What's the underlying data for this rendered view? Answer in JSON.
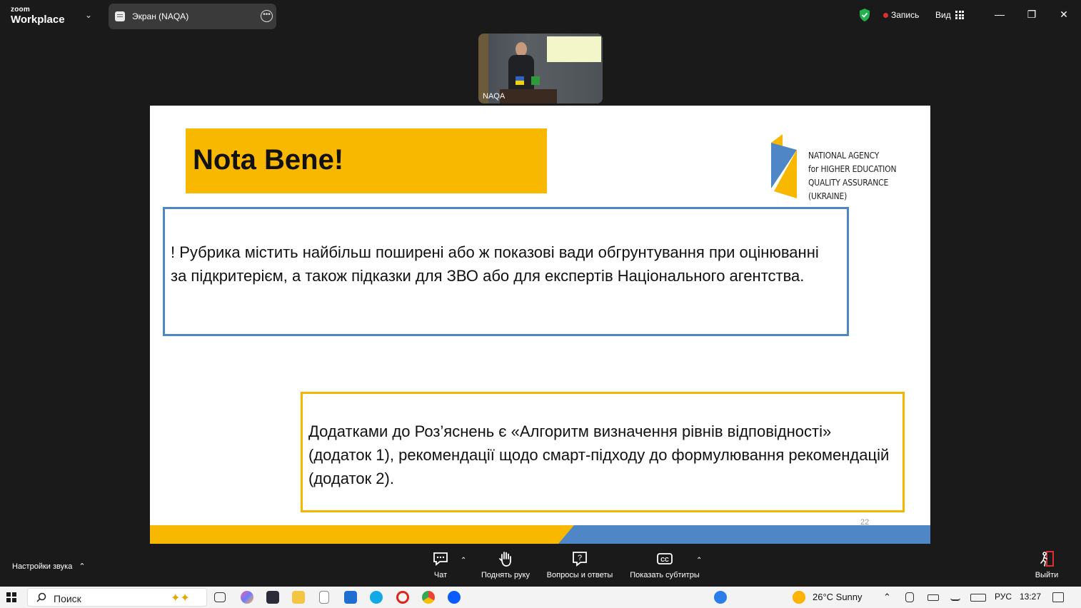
{
  "app": {
    "brand_small": "zoom",
    "brand_name": "Workplace",
    "tab_label": "Экран (NAQA)",
    "record_label": "Запись",
    "view_label": "Вид",
    "colors": {
      "bg": "#1a1a1a",
      "record": "#e02f2f",
      "shield": "#22b14c"
    }
  },
  "video": {
    "name": "NAQA"
  },
  "slide": {
    "heading": "Nota Bene!",
    "logo_lines": [
      "NATIONAL AGENCY",
      "for HIGHER EDUCATION",
      "QUALITY ASSURANCE",
      "(UKRAINE)"
    ],
    "box1_text": "! Рубрика містить найбільш поширені або ж показові вади обгрунтування при оцінюванні за підкритерієм, а також підказки для  ЗВО або для експертів Національного агентства.",
    "box2_text": "Додатками до Роз’яснень є «Алгоритм визначення рівнів відповідності» (додаток 1), рекомендації  щодо смарт-підходу до формулювання рекомендацій (додаток 2).",
    "page_number": "22",
    "colors": {
      "yellow": "#f9b800",
      "blue": "#4f86c6"
    }
  },
  "toolbar": {
    "audio_settings": "Настройки звука",
    "chat": "Чат",
    "raise_hand": "Поднять руку",
    "qa": "Вопросы и ответы",
    "captions": "Показать субтитры",
    "leave": "Выйти"
  },
  "taskbar": {
    "search_placeholder": "Поиск",
    "weather": "26°C  Sunny",
    "language": "РУС",
    "time": "13:27"
  }
}
